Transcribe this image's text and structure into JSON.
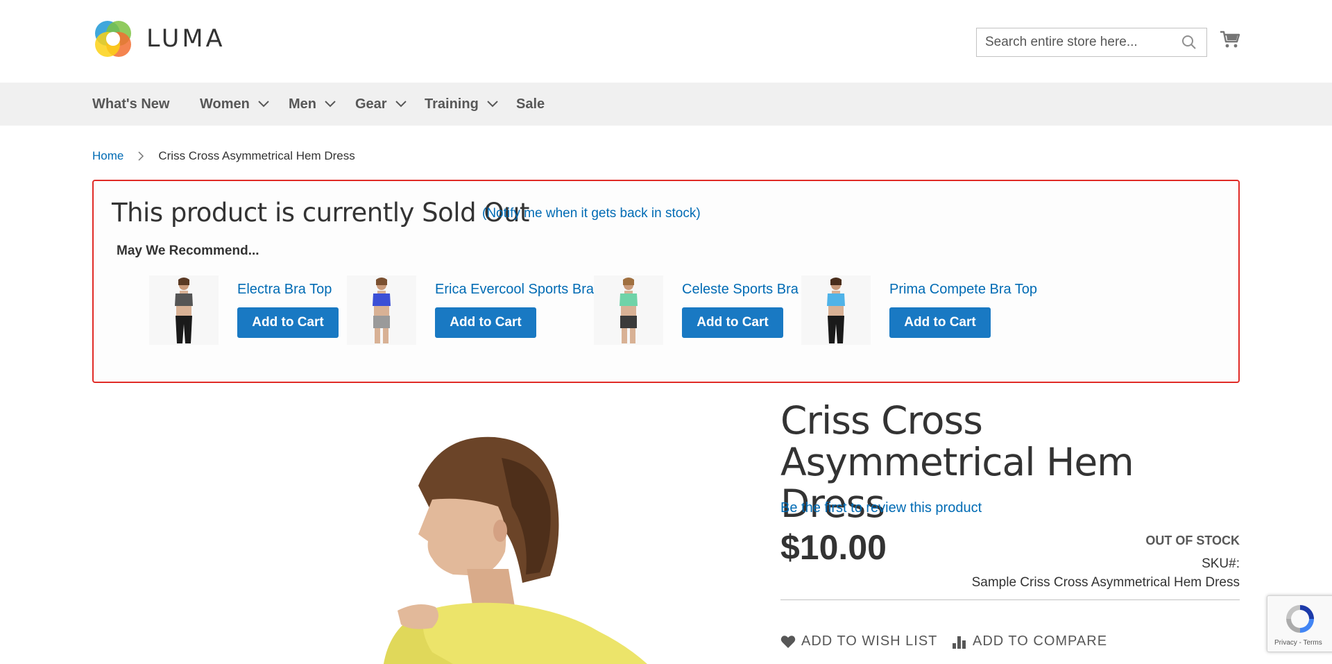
{
  "header": {
    "logo_text": "LUMA",
    "search_placeholder": "Search entire store here..."
  },
  "nav": {
    "items": [
      {
        "label": "What's New",
        "has_dropdown": false
      },
      {
        "label": "Women",
        "has_dropdown": true
      },
      {
        "label": "Men",
        "has_dropdown": true
      },
      {
        "label": "Gear",
        "has_dropdown": true
      },
      {
        "label": "Training",
        "has_dropdown": true
      },
      {
        "label": "Sale",
        "has_dropdown": false
      }
    ]
  },
  "breadcrumb": {
    "home": "Home",
    "current": "Criss Cross Asymmetrical Hem Dress"
  },
  "soldout": {
    "title": "This product is currently Sold Out",
    "notify": "(Notify me when it gets back in stock)",
    "recommend_heading": "May We Recommend...",
    "items": [
      {
        "name": "Electra Bra Top",
        "button": "Add to Cart",
        "top_color": "#555555",
        "bottom_color": "#1a1a1a"
      },
      {
        "name": "Erica Evercool Sports Bra",
        "button": "Add to Cart",
        "top_color": "#3b4fd6",
        "bottom_color": "#9a9a9a"
      },
      {
        "name": "Celeste Sports Bra",
        "button": "Add to Cart",
        "top_color": "#6fd3a8",
        "bottom_color": "#3a3a3a"
      },
      {
        "name": "Prima Compete Bra Top",
        "button": "Add to Cart",
        "top_color": "#4fb3e8",
        "bottom_color": "#1a1a1a"
      }
    ]
  },
  "product": {
    "title": "Criss Cross Asymmetrical Hem Dress",
    "review_link": "Be the first to review this product",
    "price": "$10.00",
    "stock_status": "OUT OF STOCK",
    "sku_label": "SKU#:",
    "sku_value": "Sample Criss Cross Asymmetrical Hem Dress",
    "actions": {
      "wishlist": "Add to Wish List",
      "compare": "Add to Compare"
    }
  },
  "recaptcha": {
    "text": "Privacy - Terms"
  },
  "colors": {
    "link": "#006bb4",
    "button": "#1979c3",
    "error_border": "#e02b27",
    "nav_bg": "#f0f0f0"
  }
}
